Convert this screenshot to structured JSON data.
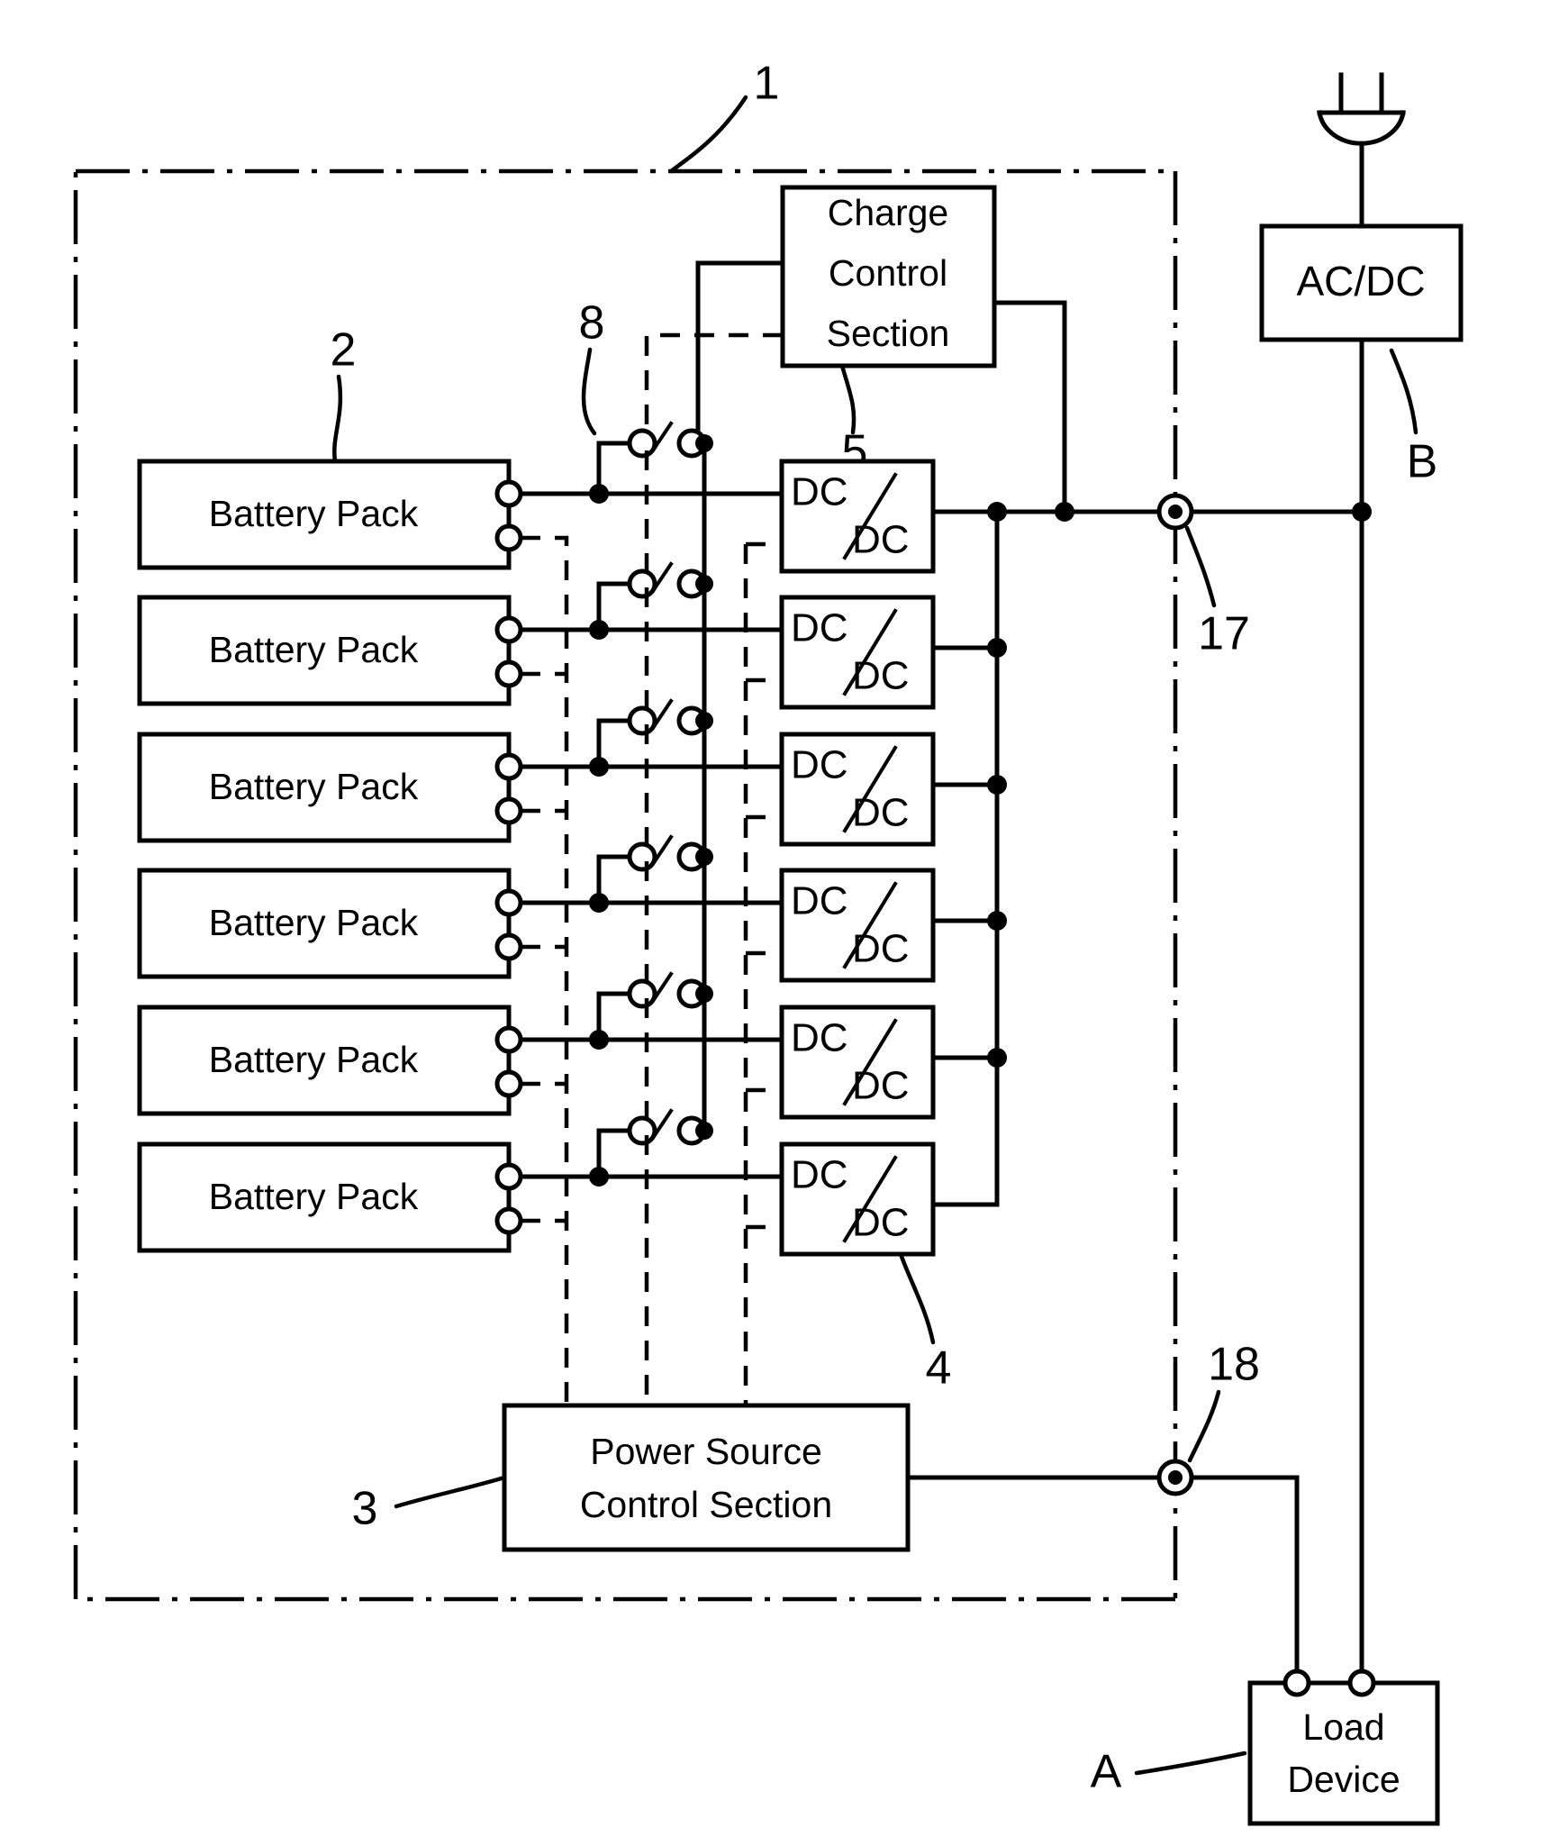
{
  "figure": {
    "type": "patent-circuit-diagram",
    "description": "Power supply apparatus block diagram with battery packs, DC/DC converters, charge control and power source control sections"
  },
  "blocks": {
    "charge_control": {
      "label_lines": [
        "Charge",
        "Control",
        "Section"
      ],
      "ref": "5"
    },
    "power_source_control": {
      "label_lines": [
        "Power Source",
        "Control Section"
      ],
      "ref": "3"
    },
    "battery_pack": {
      "label": "Battery Pack",
      "ref": "2",
      "count": 6
    },
    "dcdc": {
      "label_top": "DC",
      "label_slash": "/",
      "label_bottom": "DC",
      "ref": "4",
      "count": 6
    },
    "acdc": {
      "label": "AC/DC",
      "ref": "B"
    },
    "load_device": {
      "label_lines": [
        "Load",
        "Device"
      ],
      "ref": "A"
    }
  },
  "reference_numerals": {
    "apparatus": "1",
    "battery_pack": "2",
    "power_source_control_section": "3",
    "dcdc_converter": "4",
    "charge_control_section": "5",
    "switch": "8",
    "output_terminal_17": "17",
    "signal_terminal_18": "18",
    "load_device_mark": "A",
    "ac_adapter_mark": "B"
  },
  "icons": {
    "plug": "ac-plug-icon",
    "switch": "spst-switch-icon",
    "terminal_open": "open-terminal-icon",
    "terminal_concentric": "concentric-terminal-icon",
    "junction": "junction-dot-icon"
  },
  "colors": {
    "ink": "#000000",
    "paper": "#ffffff"
  }
}
